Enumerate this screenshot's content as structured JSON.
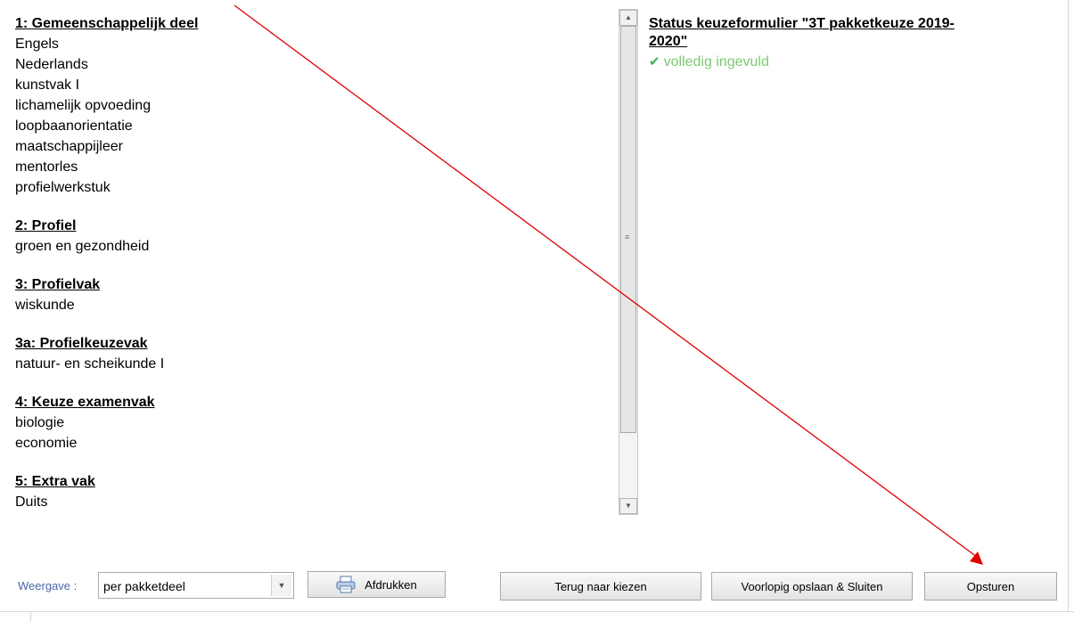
{
  "left": {
    "groups": [
      {
        "title": "1: Gemeenschappelijk deel",
        "subjects": [
          "Engels",
          "Nederlands",
          "kunstvak I",
          "lichamelijk opvoeding",
          "loopbaanorientatie",
          "maatschappijleer",
          "mentorles",
          "profielwerkstuk"
        ]
      },
      {
        "title": "2: Profiel",
        "subjects": [
          "groen en gezondheid"
        ]
      },
      {
        "title": "3: Profielvak",
        "subjects": [
          "wiskunde"
        ]
      },
      {
        "title": "3a: Profielkeuzevak",
        "subjects": [
          "natuur- en scheikunde I"
        ]
      },
      {
        "title": "4: Keuze examenvak",
        "subjects": [
          "biologie",
          "economie"
        ]
      },
      {
        "title": "5: Extra vak",
        "subjects": [
          "Duits"
        ]
      }
    ]
  },
  "status": {
    "title_line1": "Status keuzeformulier \"3T pakketkeuze 2019-",
    "title_line2": "2020\"",
    "text": "volledig ingevuld",
    "icon": "checkmark-icon",
    "color": "#7bc96f"
  },
  "footer": {
    "weergave_label": "Weergave :",
    "weergave_value": "per pakketdeel",
    "print_label": "Afdrukken",
    "back_label": "Terug naar kiezen",
    "save_label": "Voorlopig opslaan & Sluiten",
    "send_label": "Opsturen"
  },
  "annotation": {
    "color": "#e00000",
    "icon": "arrow-annotation"
  }
}
